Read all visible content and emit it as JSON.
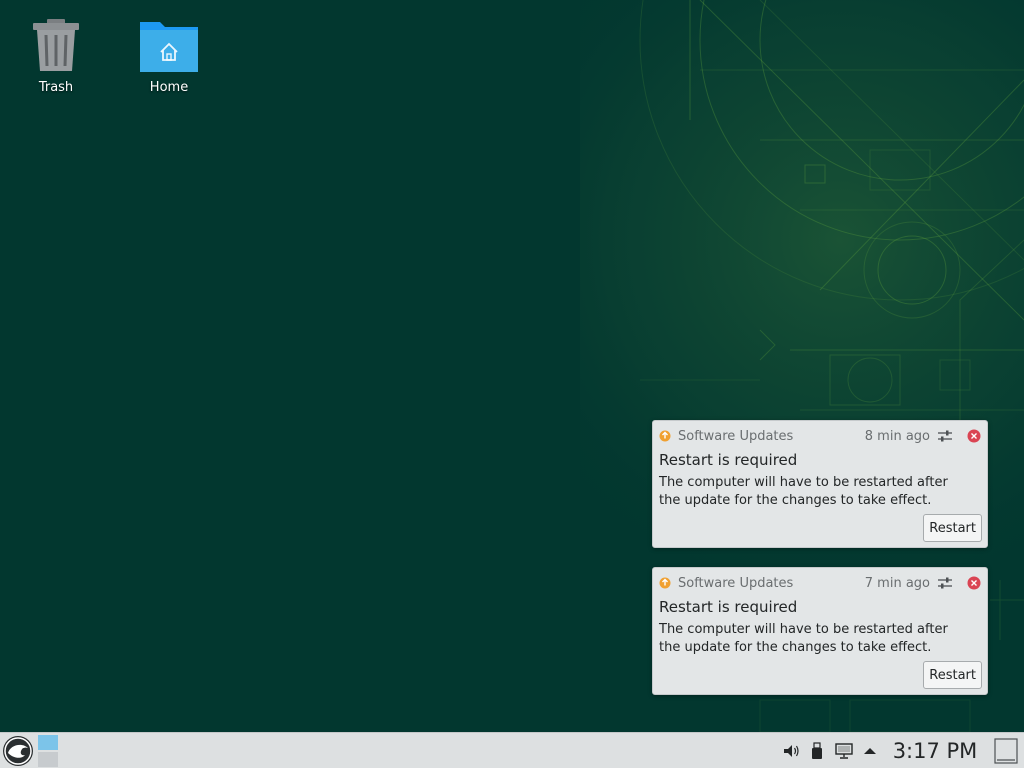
{
  "desktop": {
    "icons": [
      {
        "label": "Trash",
        "icon": "trash-icon"
      },
      {
        "label": "Home",
        "icon": "home-folder-icon"
      }
    ]
  },
  "notifications": [
    {
      "app": "Software Updates",
      "time": "8 min ago",
      "title": "Restart is required",
      "body": "The computer will have to be restarted after the update for the changes to take effect.",
      "action": "Restart"
    },
    {
      "app": "Software Updates",
      "time": "7 min ago",
      "title": "Restart is required",
      "body": "The computer will have to be restarted after the update for the changes to take effect.",
      "action": "Restart"
    }
  ],
  "taskbar": {
    "clock": "3:17 PM",
    "tray": [
      "volume-icon",
      "usb-device-icon",
      "network-icon",
      "expand-tray-arrow-icon"
    ]
  },
  "colors": {
    "desktop_bg": "#02372f",
    "wallpaper_lines": "#5a9a3c",
    "notification_bg": "#e3e6e7",
    "close_red": "#da4453",
    "app_icon_orange": "#f0a030",
    "folder_blue": "#3daee9"
  }
}
